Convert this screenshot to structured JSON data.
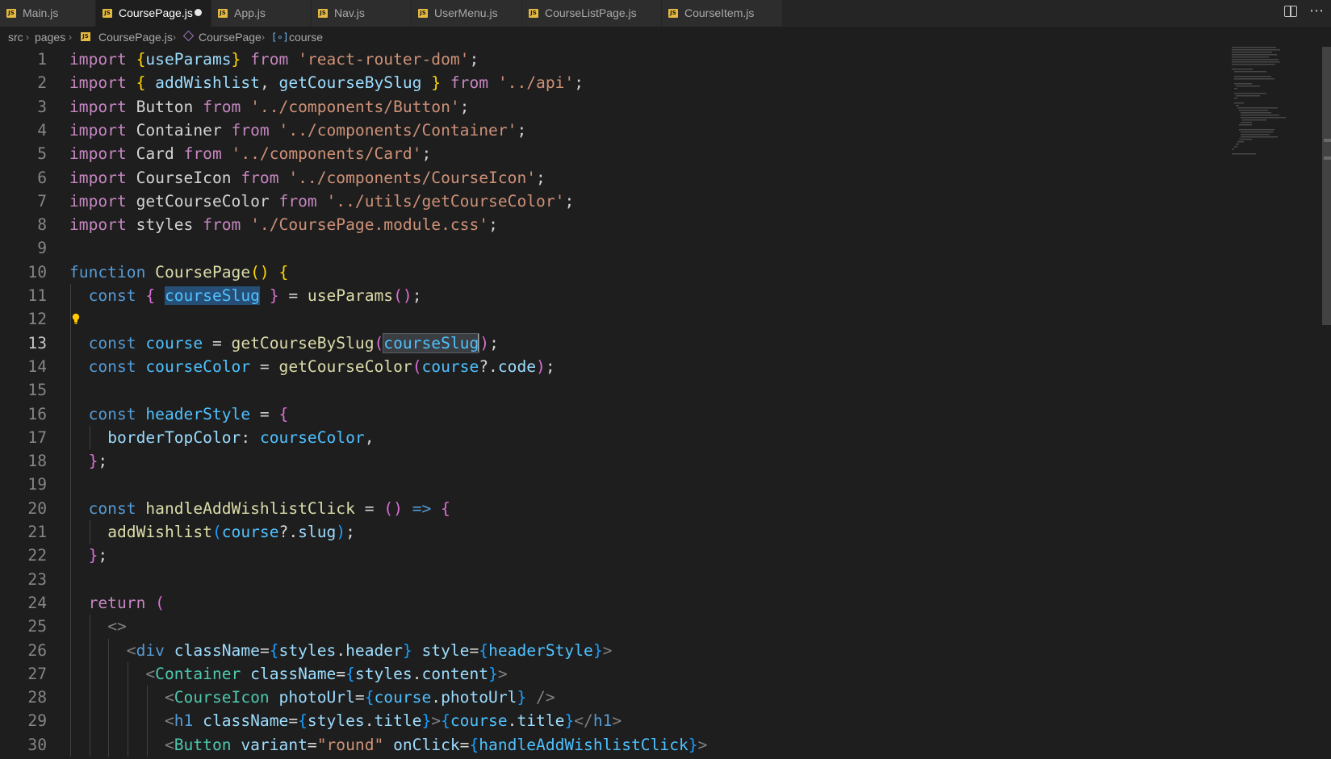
{
  "tabs": [
    {
      "label": "Main.js",
      "active": false,
      "dirty": false
    },
    {
      "label": "CoursePage.js",
      "active": true,
      "dirty": true
    },
    {
      "label": "App.js",
      "active": false,
      "dirty": false
    },
    {
      "label": "Nav.js",
      "active": false,
      "dirty": false
    },
    {
      "label": "UserMenu.js",
      "active": false,
      "dirty": false
    },
    {
      "label": "CourseListPage.js",
      "active": false,
      "dirty": false
    },
    {
      "label": "CourseItem.js",
      "active": false,
      "dirty": false
    }
  ],
  "file_badge": "JS",
  "breadcrumb": {
    "folder1": "src",
    "folder2": "pages",
    "file": "CoursePage.js",
    "symbol": "CoursePage",
    "variable": "course"
  },
  "editor": {
    "current_line": 13,
    "lines": [
      {
        "n": "1",
        "tokens": [
          [
            "import",
            "kw"
          ],
          [
            " ",
            ""
          ],
          [
            "{",
            "b1"
          ],
          [
            "useParams",
            "var"
          ],
          [
            "}",
            "b1"
          ],
          [
            " ",
            ""
          ],
          [
            "from",
            "kw"
          ],
          [
            " ",
            ""
          ],
          [
            "'react-router-dom'",
            "str"
          ],
          [
            ";",
            "p"
          ]
        ]
      },
      {
        "n": "2",
        "tokens": [
          [
            "import",
            "kw"
          ],
          [
            " ",
            ""
          ],
          [
            "{",
            "b1"
          ],
          [
            " ",
            ""
          ],
          [
            "addWishlist",
            "var"
          ],
          [
            ", ",
            "p"
          ],
          [
            "getCourseBySlug",
            "var"
          ],
          [
            " ",
            ""
          ],
          [
            "}",
            "b1"
          ],
          [
            " ",
            ""
          ],
          [
            "from",
            "kw"
          ],
          [
            " ",
            ""
          ],
          [
            "'../api'",
            "str"
          ],
          [
            ";",
            "p"
          ]
        ]
      },
      {
        "n": "3",
        "tokens": [
          [
            "import",
            "kw"
          ],
          [
            " Button ",
            "p"
          ],
          [
            "from",
            "kw"
          ],
          [
            " ",
            ""
          ],
          [
            "'../components/Button'",
            "str"
          ],
          [
            ";",
            "p"
          ]
        ]
      },
      {
        "n": "4",
        "tokens": [
          [
            "import",
            "kw"
          ],
          [
            " Container ",
            "p"
          ],
          [
            "from",
            "kw"
          ],
          [
            " ",
            ""
          ],
          [
            "'../components/Container'",
            "str"
          ],
          [
            ";",
            "p"
          ]
        ]
      },
      {
        "n": "5",
        "tokens": [
          [
            "import",
            "kw"
          ],
          [
            " Card ",
            "p"
          ],
          [
            "from",
            "kw"
          ],
          [
            " ",
            ""
          ],
          [
            "'../components/Card'",
            "str"
          ],
          [
            ";",
            "p"
          ]
        ]
      },
      {
        "n": "6",
        "tokens": [
          [
            "import",
            "kw"
          ],
          [
            " CourseIcon ",
            "p"
          ],
          [
            "from",
            "kw"
          ],
          [
            " ",
            ""
          ],
          [
            "'../components/CourseIcon'",
            "str"
          ],
          [
            ";",
            "p"
          ]
        ]
      },
      {
        "n": "7",
        "tokens": [
          [
            "import",
            "kw"
          ],
          [
            " getCourseColor ",
            "p"
          ],
          [
            "from",
            "kw"
          ],
          [
            " ",
            ""
          ],
          [
            "'../utils/getCourseColor'",
            "str"
          ],
          [
            ";",
            "p"
          ]
        ]
      },
      {
        "n": "8",
        "tokens": [
          [
            "import",
            "kw"
          ],
          [
            " styles ",
            "p"
          ],
          [
            "from",
            "kw"
          ],
          [
            " ",
            ""
          ],
          [
            "'./CoursePage.module.css'",
            "str"
          ],
          [
            ";",
            "p"
          ]
        ]
      },
      {
        "n": "9",
        "tokens": []
      },
      {
        "n": "10",
        "tokens": [
          [
            "function",
            "fn"
          ],
          [
            " ",
            ""
          ],
          [
            "CoursePage",
            "func"
          ],
          [
            "()",
            "b1"
          ],
          [
            " ",
            ""
          ],
          [
            "{",
            "b1"
          ]
        ]
      },
      {
        "n": "11",
        "tokens": [
          [
            "  ",
            ""
          ],
          [
            "const",
            "fn"
          ],
          [
            " ",
            ""
          ],
          [
            "{",
            "b2"
          ],
          [
            " ",
            ""
          ],
          [
            "courseSlug",
            "cv sel"
          ],
          [
            " ",
            ""
          ],
          [
            "}",
            "b2"
          ],
          [
            " = ",
            "p"
          ],
          [
            "useParams",
            "func"
          ],
          [
            "()",
            "b2"
          ],
          [
            ";",
            "p"
          ]
        ]
      },
      {
        "n": "12",
        "tokens": []
      },
      {
        "n": "13",
        "tokens": [
          [
            "  ",
            ""
          ],
          [
            "const",
            "fn"
          ],
          [
            " ",
            ""
          ],
          [
            "course",
            "cv"
          ],
          [
            " = ",
            "p"
          ],
          [
            "getCourseBySlug",
            "func"
          ],
          [
            "(",
            "b2"
          ],
          [
            "courseSlug",
            "cv hl"
          ],
          [
            "CURSOR",
            ""
          ],
          [
            ")",
            "b2"
          ],
          [
            ";",
            "p"
          ]
        ]
      },
      {
        "n": "14",
        "tokens": [
          [
            "  ",
            ""
          ],
          [
            "const",
            "fn"
          ],
          [
            " ",
            ""
          ],
          [
            "courseColor",
            "cv"
          ],
          [
            " = ",
            "p"
          ],
          [
            "getCourseColor",
            "func"
          ],
          [
            "(",
            "b2"
          ],
          [
            "course",
            "cv"
          ],
          [
            "?.",
            "p"
          ],
          [
            "code",
            "var"
          ],
          [
            ")",
            "b2"
          ],
          [
            ";",
            "p"
          ]
        ]
      },
      {
        "n": "15",
        "tokens": []
      },
      {
        "n": "16",
        "tokens": [
          [
            "  ",
            ""
          ],
          [
            "const",
            "fn"
          ],
          [
            " ",
            ""
          ],
          [
            "headerStyle",
            "cv"
          ],
          [
            " = ",
            "p"
          ],
          [
            "{",
            "b2"
          ]
        ]
      },
      {
        "n": "17",
        "tokens": [
          [
            "    ",
            ""
          ],
          [
            "borderTopColor",
            "var"
          ],
          [
            ": ",
            "p"
          ],
          [
            "courseColor",
            "cv"
          ],
          [
            ",",
            "p"
          ]
        ]
      },
      {
        "n": "18",
        "tokens": [
          [
            "  ",
            ""
          ],
          [
            "}",
            "b2"
          ],
          [
            ";",
            "p"
          ]
        ]
      },
      {
        "n": "19",
        "tokens": []
      },
      {
        "n": "20",
        "tokens": [
          [
            "  ",
            ""
          ],
          [
            "const",
            "fn"
          ],
          [
            " ",
            ""
          ],
          [
            "handleAddWishlistClick",
            "func"
          ],
          [
            " = ",
            "p"
          ],
          [
            "()",
            "b2"
          ],
          [
            " ",
            ""
          ],
          [
            "=>",
            "fn"
          ],
          [
            " ",
            ""
          ],
          [
            "{",
            "b2"
          ]
        ]
      },
      {
        "n": "21",
        "tokens": [
          [
            "    ",
            ""
          ],
          [
            "addWishlist",
            "func"
          ],
          [
            "(",
            "b3"
          ],
          [
            "course",
            "cv"
          ],
          [
            "?.",
            "p"
          ],
          [
            "slug",
            "var"
          ],
          [
            ")",
            "b3"
          ],
          [
            ";",
            "p"
          ]
        ]
      },
      {
        "n": "22",
        "tokens": [
          [
            "  ",
            ""
          ],
          [
            "}",
            "b2"
          ],
          [
            ";",
            "p"
          ]
        ]
      },
      {
        "n": "23",
        "tokens": []
      },
      {
        "n": "24",
        "tokens": [
          [
            "  ",
            ""
          ],
          [
            "return",
            "kw"
          ],
          [
            " ",
            ""
          ],
          [
            "(",
            "b2"
          ]
        ]
      },
      {
        "n": "25",
        "tokens": [
          [
            "    ",
            ""
          ],
          [
            "<>",
            "tag"
          ]
        ]
      },
      {
        "n": "26",
        "tokens": [
          [
            "      ",
            ""
          ],
          [
            "<",
            "tag"
          ],
          [
            "div",
            "tagn"
          ],
          [
            " ",
            ""
          ],
          [
            "className",
            "var"
          ],
          [
            "=",
            "p"
          ],
          [
            "{",
            "b3"
          ],
          [
            "styles",
            "var"
          ],
          [
            ".",
            "p"
          ],
          [
            "header",
            "var"
          ],
          [
            "}",
            "b3"
          ],
          [
            " ",
            ""
          ],
          [
            "style",
            "var"
          ],
          [
            "=",
            "p"
          ],
          [
            "{",
            "b3"
          ],
          [
            "headerStyle",
            "cv"
          ],
          [
            "}",
            "b3"
          ],
          [
            ">",
            "tag"
          ]
        ]
      },
      {
        "n": "27",
        "tokens": [
          [
            "        ",
            ""
          ],
          [
            "<",
            "tag"
          ],
          [
            "Container",
            "comp"
          ],
          [
            " ",
            ""
          ],
          [
            "className",
            "var"
          ],
          [
            "=",
            "p"
          ],
          [
            "{",
            "b3"
          ],
          [
            "styles",
            "var"
          ],
          [
            ".",
            "p"
          ],
          [
            "content",
            "var"
          ],
          [
            "}",
            "b3"
          ],
          [
            ">",
            "tag"
          ]
        ]
      },
      {
        "n": "28",
        "tokens": [
          [
            "          ",
            ""
          ],
          [
            "<",
            "tag"
          ],
          [
            "CourseIcon",
            "comp"
          ],
          [
            " ",
            ""
          ],
          [
            "photoUrl",
            "var"
          ],
          [
            "=",
            "p"
          ],
          [
            "{",
            "b3"
          ],
          [
            "course",
            "cv"
          ],
          [
            ".",
            "p"
          ],
          [
            "photoUrl",
            "var"
          ],
          [
            "}",
            "b3"
          ],
          [
            " ",
            ""
          ],
          [
            "/>",
            "tag"
          ]
        ]
      },
      {
        "n": "29",
        "tokens": [
          [
            "          ",
            ""
          ],
          [
            "<",
            "tag"
          ],
          [
            "h1",
            "tagn"
          ],
          [
            " ",
            ""
          ],
          [
            "className",
            "var"
          ],
          [
            "=",
            "p"
          ],
          [
            "{",
            "b3"
          ],
          [
            "styles",
            "var"
          ],
          [
            ".",
            "p"
          ],
          [
            "title",
            "var"
          ],
          [
            "}",
            "b3"
          ],
          [
            ">",
            "tag"
          ],
          [
            "{",
            "b3"
          ],
          [
            "course",
            "cv"
          ],
          [
            ".",
            "p"
          ],
          [
            "title",
            "var"
          ],
          [
            "}",
            "b3"
          ],
          [
            "</",
            "tag"
          ],
          [
            "h1",
            "tagn"
          ],
          [
            ">",
            "tag"
          ]
        ]
      },
      {
        "n": "30",
        "tokens": [
          [
            "          ",
            ""
          ],
          [
            "<",
            "tag"
          ],
          [
            "Button",
            "comp"
          ],
          [
            " ",
            ""
          ],
          [
            "variant",
            "var"
          ],
          [
            "=",
            "p"
          ],
          [
            "\"round\"",
            "str"
          ],
          [
            " ",
            ""
          ],
          [
            "onClick",
            "var"
          ],
          [
            "=",
            "p"
          ],
          [
            "{",
            "b3"
          ],
          [
            "handleAddWishlistClick",
            "cv"
          ],
          [
            "}",
            "b3"
          ],
          [
            ">",
            "tag"
          ]
        ]
      }
    ]
  },
  "colors": {
    "kw": "#c586c0",
    "fn": "#569cd6",
    "str": "#ce9178",
    "var": "#9cdcfe",
    "cv": "#4fc1ff",
    "func": "#dcdcaa",
    "b1": "#ffd700",
    "b2": "#da70d6",
    "b3": "#179fff",
    "p": "#d4d4d4",
    "tag": "#808080",
    "tagn": "#569cd6",
    "comp": "#4ec9b0"
  }
}
